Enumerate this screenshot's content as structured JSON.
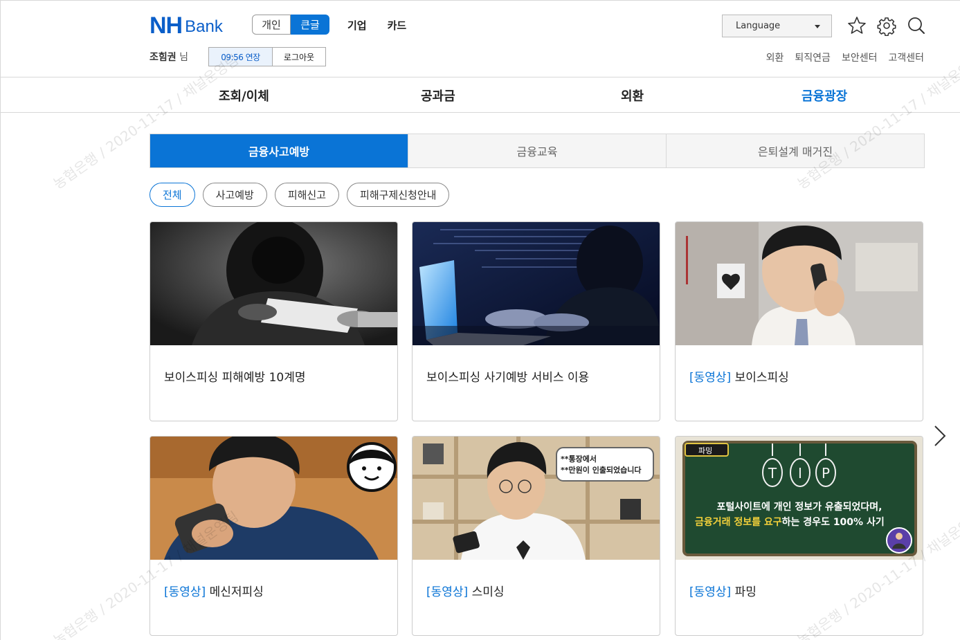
{
  "logo": {
    "nh": "NH",
    "bank": "Bank"
  },
  "mode": {
    "personal": "개인",
    "large_text": "큰글"
  },
  "top_links": [
    "기업",
    "카드"
  ],
  "user": {
    "name": "조힘권",
    "honorific": "님"
  },
  "session": {
    "time": "09:56 연장",
    "logout": "로그아웃"
  },
  "language": {
    "label": "Language"
  },
  "icons": {
    "star": "star-icon",
    "gear": "gear-icon",
    "search": "search-icon"
  },
  "util_links": [
    "외환",
    "퇴직연금",
    "보안센터",
    "고객센터"
  ],
  "gnb": [
    "조회/이체",
    "공과금",
    "외환",
    "금융광장"
  ],
  "gnb_active_index": 3,
  "tabs": [
    "금융사고예방",
    "금융교육",
    "은퇴설계 매거진"
  ],
  "tab_active_index": 0,
  "chips": [
    "전체",
    "사고예방",
    "피해신고",
    "피해구제신청안내"
  ],
  "chip_active_index": 0,
  "cards": [
    {
      "tag": "",
      "title": "보이스피싱 피해예방 10계명"
    },
    {
      "tag": "",
      "title": "보이스피싱 사기예방 서비스 이용"
    },
    {
      "tag": "[동영상]",
      "title": " 보이스피싱"
    },
    {
      "tag": "[동영상]",
      "title": " 메신저피싱"
    },
    {
      "tag": "[동영상]",
      "title": " 스미싱"
    },
    {
      "tag": "[동영상]",
      "title": " 파밍"
    }
  ],
  "card_images": {
    "smishing_bubble_line1": "**통장에서",
    "smishing_bubble_line2": "**만원이 인출되었습니다",
    "pharming_badge": "파밍",
    "pharming_tip": [
      "T",
      "I",
      "P"
    ],
    "pharming_line1": "포털사이트에 개인 정보가 유출되었다며,",
    "pharming_line2_highlight": "금융거래 정보를 요구",
    "pharming_line2_rest": "하는 경우도 100% 사기"
  },
  "watermark": "농협은행 / 2020-11-17 / 채널운영팀"
}
